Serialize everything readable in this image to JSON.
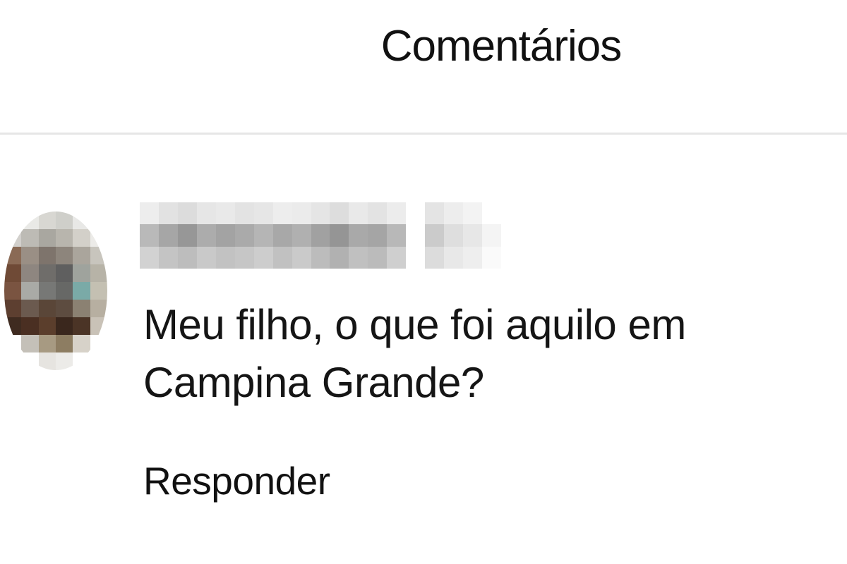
{
  "header": {
    "title": "Comentários"
  },
  "comment": {
    "username": "",
    "text": "Meu filho, o que foi aquilo em Campina Grande?",
    "reply_label": "Responder"
  },
  "colors": {
    "divider": "#e6e6e6",
    "text": "#111111",
    "background": "#ffffff"
  }
}
